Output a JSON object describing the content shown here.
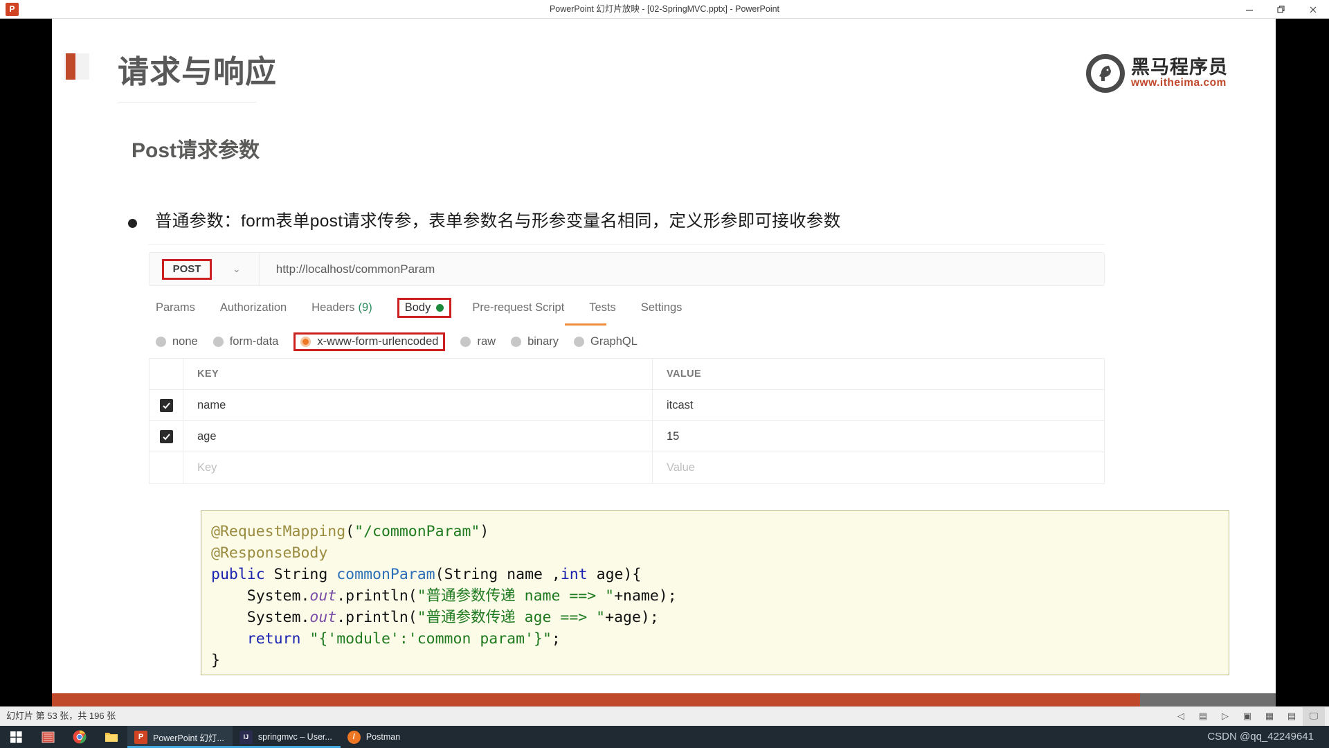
{
  "window": {
    "title": "PowerPoint 幻灯片放映  -  [02-SpringMVC.pptx]  -  PowerPoint",
    "app_icon": "powerpoint-icon",
    "minimize_label": "–",
    "restore_label": "❐",
    "close_label": "✕"
  },
  "slide": {
    "title": "请求与响应",
    "section_title": "Post请求参数",
    "bullet": "普通参数：form表单post请求传参，表单参数名与形参变量名相同，定义形参即可接收参数",
    "logo": {
      "cn": "黑马程序员",
      "url": "www.itheima.com"
    }
  },
  "postman": {
    "method": "POST",
    "method_caret": "⌄",
    "url": "http://localhost/commonParam",
    "tabs": [
      {
        "label": "Params",
        "count": "",
        "selected": false
      },
      {
        "label": "Authorization",
        "count": "",
        "selected": false
      },
      {
        "label": "Headers",
        "count": "(9)",
        "selected": false
      },
      {
        "label": "Body",
        "count": "",
        "selected": true
      },
      {
        "label": "Pre-request Script",
        "count": "",
        "selected": false
      },
      {
        "label": "Tests",
        "count": "",
        "selected": false
      },
      {
        "label": "Settings",
        "count": "",
        "selected": false
      }
    ],
    "body_types": [
      {
        "label": "none",
        "selected": false
      },
      {
        "label": "form-data",
        "selected": false
      },
      {
        "label": "x-www-form-urlencoded",
        "selected": true
      },
      {
        "label": "raw",
        "selected": false
      },
      {
        "label": "binary",
        "selected": false
      },
      {
        "label": "GraphQL",
        "selected": false
      }
    ],
    "table": {
      "headers": {
        "key": "KEY",
        "value": "VALUE"
      },
      "rows": [
        {
          "checked": true,
          "key": "name",
          "value": "itcast"
        },
        {
          "checked": true,
          "key": "age",
          "value": "15"
        }
      ],
      "placeholder_row": {
        "key": "Key",
        "value": "Value"
      }
    },
    "colors": {
      "highlight_box": "#cc1f1f",
      "accent_orange": "#ef7622",
      "green_dot": "#1b8a3b",
      "tab_underline": "#ef8d3c"
    }
  },
  "code": {
    "line1_ann": "@RequestMapping",
    "line1_open": "(",
    "line1_str": "\"/commonParam\"",
    "line1_close": ")",
    "line2_ann": "@ResponseBody",
    "line3_kw1": "public",
    "line3_type": " String ",
    "line3_method": "commonParam",
    "line3_args_a": "(String name ,",
    "line3_kw2": "int",
    "line3_args_b": " age){",
    "line4_pre": "    System.",
    "line4_fld": "out",
    "line4_call": ".println(",
    "line4_str": "\"普通参数传递 name ==> \"",
    "line4_post": "+name);",
    "line5_pre": "    System.",
    "line5_fld": "out",
    "line5_call": ".println(",
    "line5_str": "\"普通参数传递 age ==> \"",
    "line5_post": "+age);",
    "line6_kw": "    return",
    "line6_str": " \"{'module':'common param'}\"",
    "line6_post": ";",
    "line7": "}"
  },
  "status": {
    "text": "幻灯片 第 53 张，共 196 张",
    "icons": [
      {
        "name": "previous-slide-icon",
        "glyph": "◁",
        "active": false
      },
      {
        "name": "menu-icon",
        "glyph": "▤",
        "active": false
      },
      {
        "name": "next-slide-icon",
        "glyph": "▷",
        "active": false
      },
      {
        "name": "normal-view-icon",
        "glyph": "▣",
        "active": false
      },
      {
        "name": "slide-sorter-icon",
        "glyph": "▦",
        "active": false
      },
      {
        "name": "reading-view-icon",
        "glyph": "▤",
        "active": false
      },
      {
        "name": "slideshow-icon",
        "glyph": "🖵",
        "active": true
      }
    ]
  },
  "progress": {
    "percent": 89
  },
  "taskbar": {
    "start_label": "⊞",
    "pinned": [
      {
        "name": "bandizip-icon",
        "glyph": "▩"
      },
      {
        "name": "chrome-icon",
        "glyph": "◉"
      },
      {
        "name": "file-explorer-icon",
        "glyph": "🗀"
      }
    ],
    "tasks": [
      {
        "name": "powerpoint-task",
        "label": "PowerPoint 幻灯...",
        "icon_letter": "P",
        "icon_color": "#d04423",
        "active": true
      },
      {
        "name": "intellij-task",
        "label": "springmvc – User...",
        "icon_letter": "IJ",
        "icon_color": "#2b2b4f",
        "active": false
      },
      {
        "name": "postman-task",
        "label": "Postman",
        "icon_letter": "/",
        "icon_color": "#ef7622",
        "active": false
      }
    ],
    "watermark": "CSDN @qq_42249641"
  }
}
